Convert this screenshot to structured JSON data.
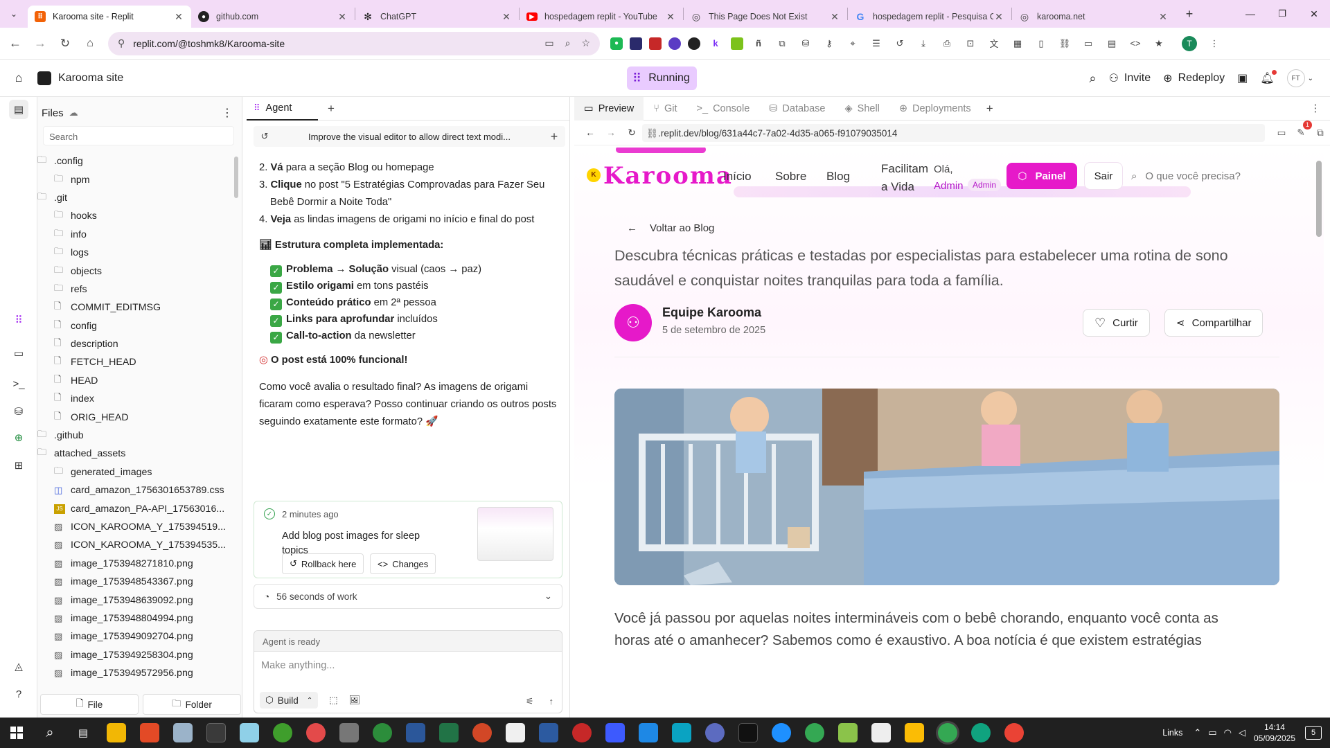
{
  "browser": {
    "tabs": [
      {
        "title": "Karooma site - Replit",
        "icon": "replit-icon",
        "active": true
      },
      {
        "title": "github.com",
        "icon": "github-icon"
      },
      {
        "title": "ChatGPT",
        "icon": "chatgpt-icon"
      },
      {
        "title": "hospedagem replit - YouTube",
        "icon": "youtube-icon"
      },
      {
        "title": "This Page Does Not Exist",
        "icon": "globe-icon"
      },
      {
        "title": "hospedagem replit - Pesquisa G",
        "icon": "google-icon"
      },
      {
        "title": "karooma.net",
        "icon": "globe-icon"
      }
    ],
    "url": "replit.com/@toshmk8/Karooma-site",
    "profile_initial": "T"
  },
  "replit": {
    "project_name": "Karooma site",
    "run_status": "Running",
    "invite_label": "Invite",
    "redeploy_label": "Redeploy",
    "avatar_initials": "FT"
  },
  "files_panel": {
    "title": "Files",
    "search_placeholder": "Search",
    "items": [
      {
        "name": ".config",
        "type": "folder",
        "depth": 0
      },
      {
        "name": "npm",
        "type": "folder",
        "depth": 1
      },
      {
        "name": ".git",
        "type": "folder",
        "depth": 0
      },
      {
        "name": "hooks",
        "type": "folder",
        "depth": 1
      },
      {
        "name": "info",
        "type": "folder",
        "depth": 1
      },
      {
        "name": "logs",
        "type": "folder",
        "depth": 1
      },
      {
        "name": "objects",
        "type": "folder",
        "depth": 1
      },
      {
        "name": "refs",
        "type": "folder",
        "depth": 1
      },
      {
        "name": "COMMIT_EDITMSG",
        "type": "file",
        "depth": 1
      },
      {
        "name": "config",
        "type": "file",
        "depth": 1
      },
      {
        "name": "description",
        "type": "file",
        "depth": 1
      },
      {
        "name": "FETCH_HEAD",
        "type": "file",
        "depth": 1
      },
      {
        "name": "HEAD",
        "type": "file",
        "depth": 1
      },
      {
        "name": "index",
        "type": "file",
        "depth": 1
      },
      {
        "name": "ORIG_HEAD",
        "type": "file",
        "depth": 1
      },
      {
        "name": ".github",
        "type": "folder",
        "depth": 0
      },
      {
        "name": "attached_assets",
        "type": "folder",
        "depth": 0
      },
      {
        "name": "generated_images",
        "type": "folder",
        "depth": 1
      },
      {
        "name": "card_amazon_1756301653789.css",
        "type": "css",
        "depth": 1
      },
      {
        "name": "card_amazon_PA-API_17563016...",
        "type": "js",
        "depth": 1
      },
      {
        "name": "ICON_KAROOMA_Y_175394519...",
        "type": "image",
        "depth": 1
      },
      {
        "name": "ICON_KAROOMA_Y_175394535...",
        "type": "image",
        "depth": 1
      },
      {
        "name": "image_1753948271810.png",
        "type": "image",
        "depth": 1
      },
      {
        "name": "image_1753948543367.png",
        "type": "image",
        "depth": 1
      },
      {
        "name": "image_1753948639092.png",
        "type": "image",
        "depth": 1
      },
      {
        "name": "image_1753948804994.png",
        "type": "image",
        "depth": 1
      },
      {
        "name": "image_1753949092704.png",
        "type": "image",
        "depth": 1
      },
      {
        "name": "image_1753949258304.png",
        "type": "image",
        "depth": 1
      },
      {
        "name": "image_1753949572956.png",
        "type": "image",
        "depth": 1
      }
    ],
    "new_file_label": "File",
    "new_folder_label": "Folder"
  },
  "agent": {
    "tab_label": "Agent",
    "thread_title": "Improve the visual editor to allow direct text modi...",
    "steps": [
      {
        "num": "2.",
        "bold": "Vá",
        "text": " para a seção Blog ou homepage"
      },
      {
        "num": "3.",
        "bold": "Clique",
        "text": " no post \"5 Estratégias Comprovadas para Fazer Seu Bebê Dormir a Noite Toda\""
      },
      {
        "num": "4.",
        "bold": "Veja",
        "text": " as lindas imagens de origami no início e final do post"
      }
    ],
    "structure_heading": "Estrutura completa implementada:",
    "checklist": [
      {
        "bold": "Problema → Solução",
        "text": " visual (caos → paz)"
      },
      {
        "bold": "Estilo origami",
        "text": " em tons pastéis"
      },
      {
        "bold": "Conteúdo prático",
        "text": " em 2ª pessoa"
      },
      {
        "bold": "Links para aprofundar",
        "text": " incluídos"
      },
      {
        "bold": "Call-to-action",
        "text": " da newsletter"
      }
    ],
    "functional_line": "O post está 100% funcional!",
    "question": "Como você avalia o resultado final? As imagens de origami ficaram como esperava? Posso continuar criando os outros posts seguindo exatamente este formato? 🚀",
    "checkpoint": {
      "time": "2 minutes ago",
      "message": "Add blog post images for sleep topics",
      "rollback_label": "Rollback here",
      "changes_label": "Changes"
    },
    "work_summary": "56 seconds of work",
    "status": "Agent is ready",
    "input_placeholder": "Make anything...",
    "mode_label": "Build"
  },
  "preview_panel": {
    "tabs": [
      "Preview",
      "Git",
      "Console",
      "Database",
      "Shell",
      "Deployments"
    ],
    "url": ".replit.dev/blog/631a44c7-7a02-4d35-a065-f91079035014",
    "notification_count": "1"
  },
  "site": {
    "logo_text": "Karooma",
    "nav": [
      "Início",
      "Sobre",
      "Blog"
    ],
    "nav_tagline_1": "Facilitam",
    "nav_tagline_2": "a Vida",
    "greeting": "Olá,",
    "user_name": "Admin",
    "role_badge": "Admin",
    "panel_label": "Painel",
    "logout_label": "Sair",
    "search_placeholder": "O que você precisa?",
    "back_label": "Voltar ao Blog",
    "excerpt": "Descubra técnicas práticas e testadas por especialistas para estabelecer uma rotina de sono saudável e conquistar noites tranquilas para toda a família.",
    "author": "Equipe Karooma",
    "date": "5 de setembro de 2025",
    "like_label": "Curtir",
    "share_label": "Compartilhar",
    "body_line_1": "Você já passou por aquelas noites intermináveis com o bebê chorando, enquanto você conta as",
    "body_line_2": "horas até o amanhecer? Sabemos como é exaustivo. A boa notícia é que existem estratégias",
    "brand_color": "#e619c9"
  },
  "taskbar": {
    "links_label": "Links",
    "time": "14:14",
    "date": "05/09/2025",
    "notif_count": "5"
  }
}
